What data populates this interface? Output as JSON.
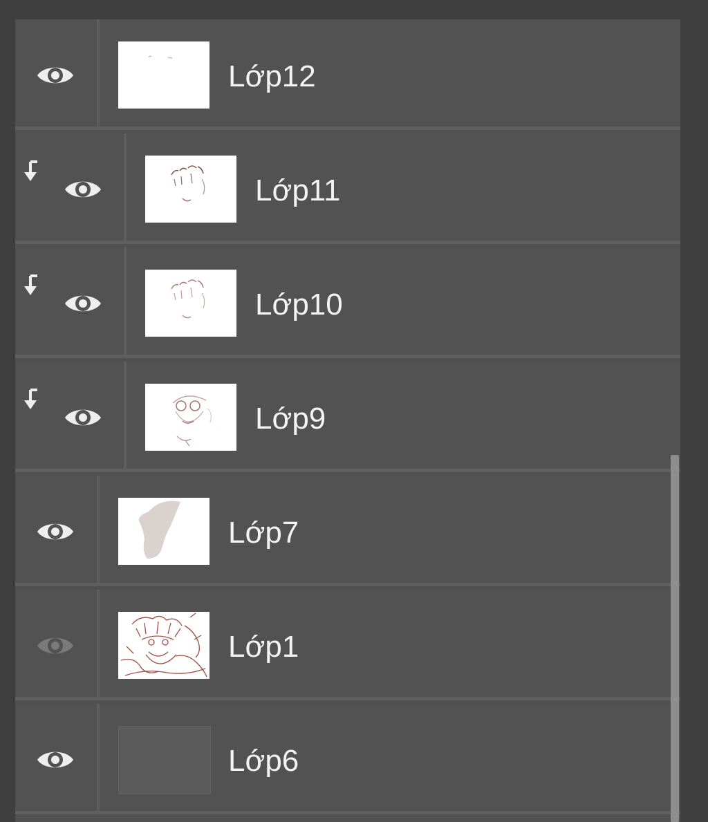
{
  "layers_panel": {
    "layers": [
      {
        "name": "Lớp12",
        "visible": true,
        "clipping": false,
        "thumbnail_icon": "blank-white-thumbnail"
      },
      {
        "name": "Lớp11",
        "visible": true,
        "clipping": true,
        "thumbnail_icon": "hair-lineart-thumbnail"
      },
      {
        "name": "Lớp10",
        "visible": true,
        "clipping": true,
        "thumbnail_icon": "hair-lineart-thumbnail"
      },
      {
        "name": "Lớp9",
        "visible": true,
        "clipping": true,
        "thumbnail_icon": "face-sketch-thumbnail"
      },
      {
        "name": "Lớp7",
        "visible": true,
        "clipping": false,
        "thumbnail_icon": "grey-silhouette-thumbnail"
      },
      {
        "name": "Lớp1",
        "visible": false,
        "clipping": false,
        "thumbnail_icon": "red-sketch-thumbnail"
      },
      {
        "name": "Lớp6",
        "visible": true,
        "clipping": false,
        "thumbnail_icon": "dark-fill-thumbnail"
      }
    ],
    "colors": {
      "panel_bg": "#525252",
      "separator": "#5f5f5f",
      "text": "#f3f3f3",
      "eye_visible": "#eeeeee",
      "eye_hidden": "#7a7a7a",
      "sketch_red": "#a04b3e"
    }
  }
}
